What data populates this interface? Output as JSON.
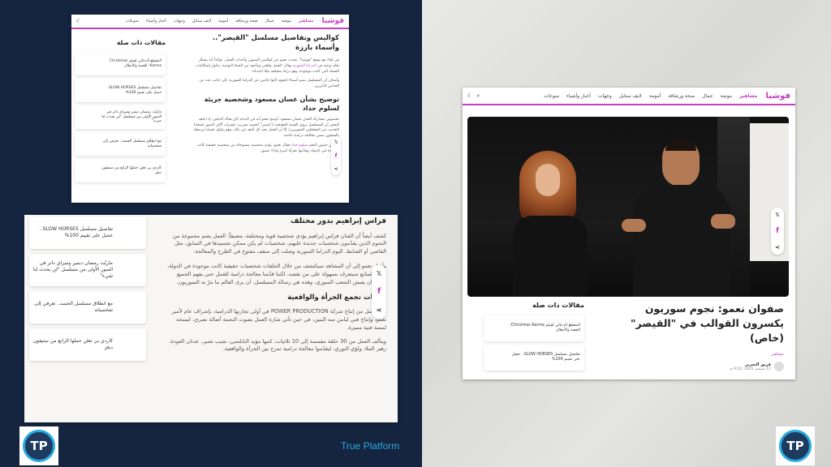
{
  "nav": {
    "brand": "فوشيا",
    "items": [
      "مشاهير",
      "موضة",
      "جمال",
      "صحة ورشاقة",
      "أمومة",
      "لايف ستايل",
      "وجهات",
      "أخبار وأشياء",
      "منوعات"
    ],
    "tools": [
      "☾",
      "⌕"
    ]
  },
  "shot1": {
    "title": "كواليس وتفاصيل مسلسل \"القيصر\".. وأسماء بارزة",
    "p1": "في لقاء مع موقع \"فوشيا\"، تحدث نعمو عن كواليس التصوير وأحداث العمل، مؤكداً أنه يشكل نقلة نوعية في",
    "p1_link": "الدراما السورية",
    "p1_end": "وقال: العمل واقعي ومأخوذ من الحياة اليومية، يتناول إشكاليات الفساد التي كانت موجودة، وهو دراما مختلفة عمّا اعتدناه.",
    "p2": "وأضاف أن المسلسل يضم أسماء لنجوم كانوا غائبين عن الدراما السورية، إلى جانب عدد من الفنانين البارزين.",
    "h2": "توضيح بشأن غسان مسعود وشخصية جريئة لسلوم حداد",
    "p3": "بخصوص مشاركة الفنان غسان مسعود، أوضح نعمو أنه في البداية كان هناك التباس، إذ اعتقد البعض أن المسلسل يروي القصة الحقيقية لـ\"قيصر\" (قضية تسريب عشرات آلاف الصور لضحايا التعذيب من المعتقلين السوريين)، إلا أن العمل بعيد كل البعد عن ذلك، وهو يتناول قضايا مرتبطة بالسجون ضمن معالجة درامية خاصة.",
    "p4": "أما عن حضور النجم",
    "p4_link": "سلوم حداد",
    "p4_end": "فقال نعمو: يؤدي شخصية مستوحاة من شخصية حقيقية كانت موجودة في الدولة، وقدّمها بجرأة كبيرة وأداء عميق.",
    "related_title": "مقالات ذات صلة",
    "related": [
      "المقطع الدعائي لفيلم Christmas Karma: القصة والأبطال",
      "تفاصيل مسلسل SLOW HORSES.. حصل على تقييم 100%",
      "ماريّت رمضان ديمير وميراي دانر في الصور الأولى من مسلسل \"لن يحدث لنا شيء\"",
      "مع انطلاق مسلسل الحسد.. تعرفي إلى شخصياته",
      "كاردي بي تعلن حملها الرابع من ستيفون ديغز"
    ]
  },
  "shot2": {
    "h1": "فراس إبراهيم بدور مختلف",
    "p1": "كشف أيضاً أن الفنان فراس إبراهيم يؤدي شخصية قوية ومختلفة، مضيفاً: العمل يضم مجموعة من النجوم الذين يقدّمون شخصيات جديدة عليهم، شخصيات لم يكن ممكن تجسيدها في السابق، مثل القاضي أو الضابط. اليوم الدراما السورية وصلت إلى سقف مفتوح في الطرح والمعالجة.",
    "p2": "وأشار نعمو إلى أن المشاهد سيكتشف من خلال الحلقات شخصيات حقيقية كانت موجودة في الدولة، قائلاً: المتابع سيتعرف بسهولة على من نقصد، لكننا قدّمنا معالجة درامية للعمل حتى يفهم الجميع كيف كان يعيش الشعب السوري، وهذه هي رسالة المسلسل، أن يرى العالم ما مرّ به السوريون.",
    "h2": "ثلاثيات تجمع الجرأة والواقعية",
    "p3": "المسلسل من إنتاج شركة POWER PRODUCTION في أولى تجاربها الدرامية، بإشراف عام لأمير نعمو، وإنتاج فني لبامن سه البنين، في حين تأتي شارة العمل بصوت النجمة أصالة نصري، لتمنحه لمسة فنية مميزة.",
    "p4": "ويتألف العمل من 30 حلقة مقسمة إلى 10 ثلاثيات، كتبها مؤيد النابلسي، نجيب نصير، عدنان العودة، زهير الملا، ولؤي النوري، ليقدّموا معالجة درامية تمزج بين الجرأة والواقعية.",
    "related": [
      "تفاصيل مسلسل SLOW HORSES.. حصل على تقييم 100%",
      "ماريّت رمضان ديمير وميراي دانر في الصور الأولى من مسلسل \"لن يحدث لنا شيء\"",
      "مع انطلاق مسلسل الحسد.. تعرفي إلى شخصياته",
      "كاردي بي تعلن حملها الرابع من ستيفون ديغز"
    ]
  },
  "shot3": {
    "title": "صفوان نعمو: نجوم سوريون يكسرون القوالب في \"القيصر\" (خاص)",
    "category": "مشاهير",
    "author": "فريق التحرير",
    "date": "11 سبتمبر 2025 ,9:10 م",
    "related_title": "مقالات ذات صلة",
    "related": [
      "المقطع الدعائي لفيلم Christmas Karma: القصة والأبطال",
      "تفاصيل مسلسل SLOW HORSES.. حصل على تقييم 100%"
    ]
  },
  "share": {
    "x": "𝕏",
    "fb": "f",
    "share": "⋖"
  },
  "logo": {
    "text": "TP"
  },
  "caption": "True Platform"
}
